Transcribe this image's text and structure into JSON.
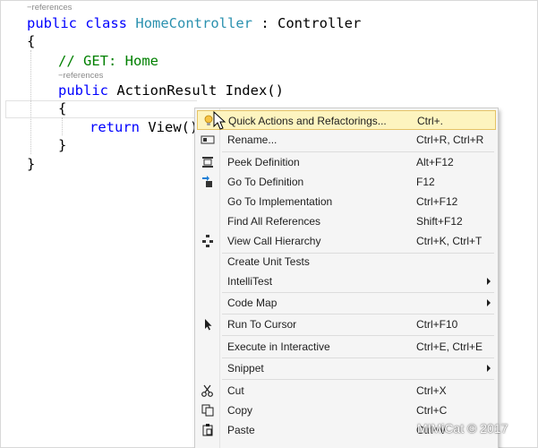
{
  "editor": {
    "lens_class": "−references",
    "line_class": {
      "kw1": "public",
      "kw2": "class",
      "type": "HomeController",
      "rest": " : Controller"
    },
    "brace_open_1": "{",
    "comment": "// GET: Home",
    "lens_method": "−references",
    "line_method": {
      "kw": "public",
      "rest": " ActionResult Index()"
    },
    "brace_open_2": "{",
    "line_return": {
      "kw": "return",
      "rest": " View()"
    },
    "brace_close_2": "}",
    "brace_close_1": "}"
  },
  "menu": {
    "items": [
      {
        "label": "Quick Actions and Refactorings...",
        "shortcut": "Ctrl+.",
        "icon": "lightbulb-icon"
      },
      {
        "label": "Rename...",
        "shortcut": "Ctrl+R, Ctrl+R",
        "icon": "rename-icon"
      },
      {
        "label": "Peek Definition",
        "shortcut": "Alt+F12",
        "icon": "peek-definition-icon"
      },
      {
        "label": "Go To Definition",
        "shortcut": "F12",
        "icon": "go-to-definition-icon"
      },
      {
        "label": "Go To Implementation",
        "shortcut": "Ctrl+F12"
      },
      {
        "label": "Find All References",
        "shortcut": "Shift+F12"
      },
      {
        "label": "View Call Hierarchy",
        "shortcut": "Ctrl+K, Ctrl+T",
        "icon": "call-hierarchy-icon"
      },
      {
        "label": "Create Unit Tests",
        "shortcut": ""
      },
      {
        "label": "IntelliTest",
        "shortcut": ""
      },
      {
        "label": "Code Map",
        "shortcut": ""
      },
      {
        "label": "Run To Cursor",
        "shortcut": "Ctrl+F10",
        "icon": "run-to-cursor-icon"
      },
      {
        "label": "Execute in Interactive",
        "shortcut": "Ctrl+E, Ctrl+E"
      },
      {
        "label": "Snippet",
        "shortcut": ""
      },
      {
        "label": "Cut",
        "shortcut": "Ctrl+X",
        "icon": "scissors-icon"
      },
      {
        "label": "Copy",
        "shortcut": "Ctrl+C",
        "icon": "copy-icon"
      },
      {
        "label": "Paste",
        "shortcut": "Ctrl+V",
        "icon": "paste-icon"
      }
    ]
  },
  "watermark": "MIMiCat © 2017",
  "colors": {
    "keyword": "#0000ff",
    "type": "#2b91af",
    "comment": "#008000",
    "highlight": "#fdf4bf"
  }
}
